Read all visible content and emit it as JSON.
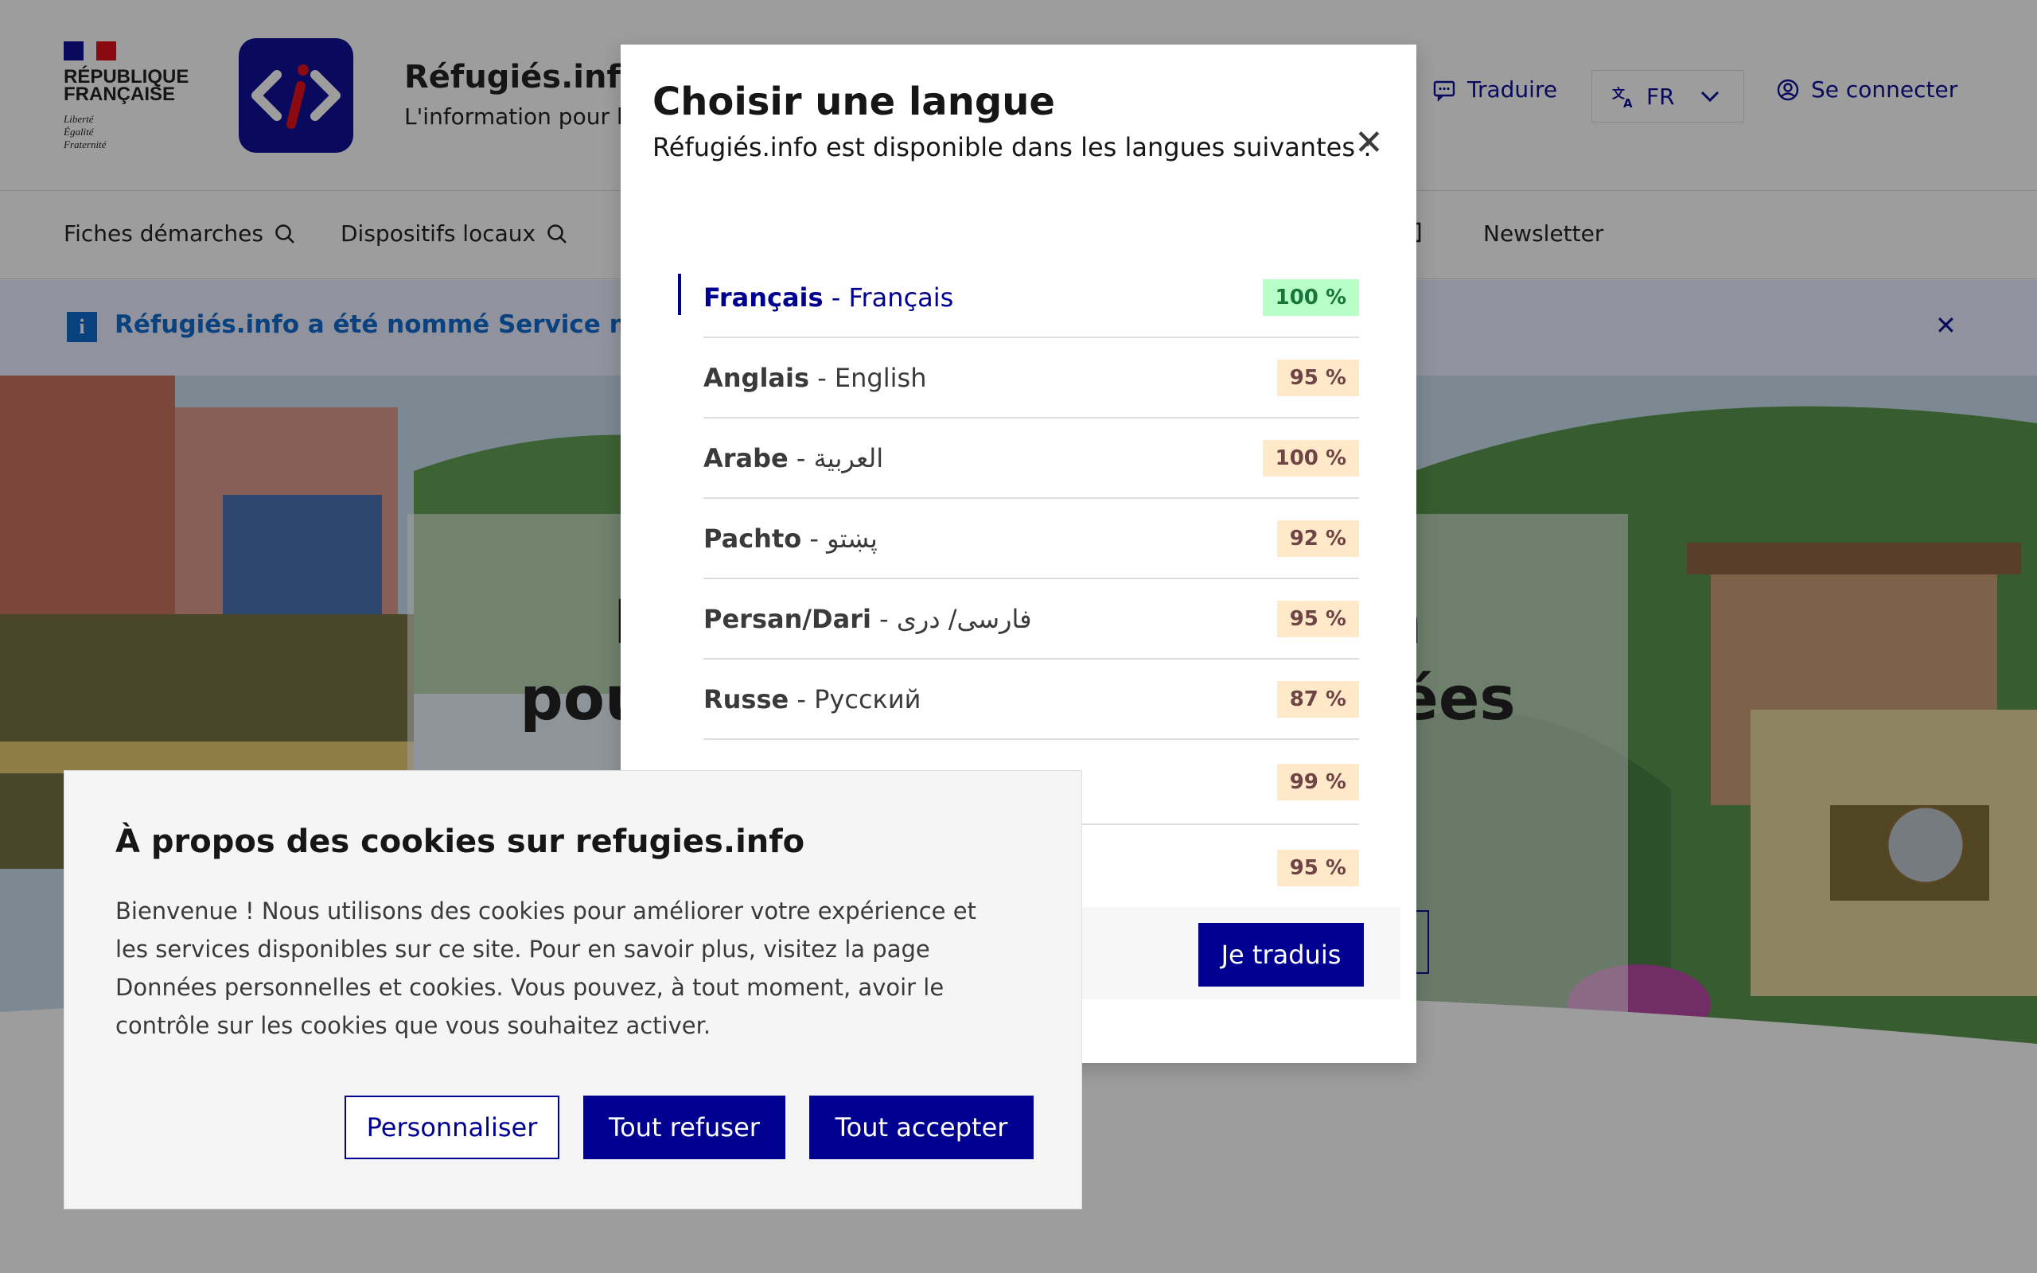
{
  "header": {
    "republic": "RÉPUBLIQUE\nFRANÇAISE",
    "motto": "Liberté\nÉgalité\nFraternité",
    "site_title": "Réfugiés.info",
    "tagline": "L'information pour les réfugiés",
    "translate_label": "Traduire",
    "lang_code": "FR",
    "login_label": "Se connecter"
  },
  "nav": {
    "item1": "Fiches démarches",
    "item2": "Dispositifs locaux",
    "item5": "Newsletter"
  },
  "notice": {
    "text": "Réfugiés.info a été nommé Service numérique"
  },
  "hero": {
    "title": "Le portail d'information\npour les personnes réfugiées",
    "sub_fragment": "e"
  },
  "lang_modal": {
    "title": "Choisir une langue",
    "subtitle": "Réfugiés.info est disponible dans les langues suivantes :",
    "languages": [
      {
        "fr": "Français",
        "native": "Français",
        "pct": "100 %"
      },
      {
        "fr": "Anglais",
        "native": "English",
        "pct": "95 %"
      },
      {
        "fr": "Arabe",
        "native": "العربية",
        "pct": "100 %"
      },
      {
        "fr": "Pachto",
        "native": "پښتو",
        "pct": "92 %"
      },
      {
        "fr": "Persan/Dari",
        "native": "فارسی/ دری",
        "pct": "95 %"
      },
      {
        "fr": "Russe",
        "native": "Русский",
        "pct": "87 %"
      },
      {
        "fr": "",
        "native": "",
        "pct": "99 %"
      },
      {
        "fr": "",
        "native": "",
        "pct": "95 %"
      }
    ],
    "translate_button": "Je traduis"
  },
  "cookie": {
    "title": "À propos des cookies sur refugies.info",
    "body": "Bienvenue ! Nous utilisons des cookies pour améliorer votre expérience et les services disponibles sur ce site. Pour en savoir plus, visitez la page Données personnelles et cookies.  Vous pouvez, à tout moment, avoir le contrôle sur les cookies que vous souhaitez activer.",
    "customize": "Personnaliser",
    "refuse": "Tout refuser",
    "accept": "Tout accepter"
  },
  "colors": {
    "primary": "#000091",
    "info": "#0063cb",
    "success_bg": "#b8fec9",
    "warning_bg": "#ffe9c8"
  }
}
